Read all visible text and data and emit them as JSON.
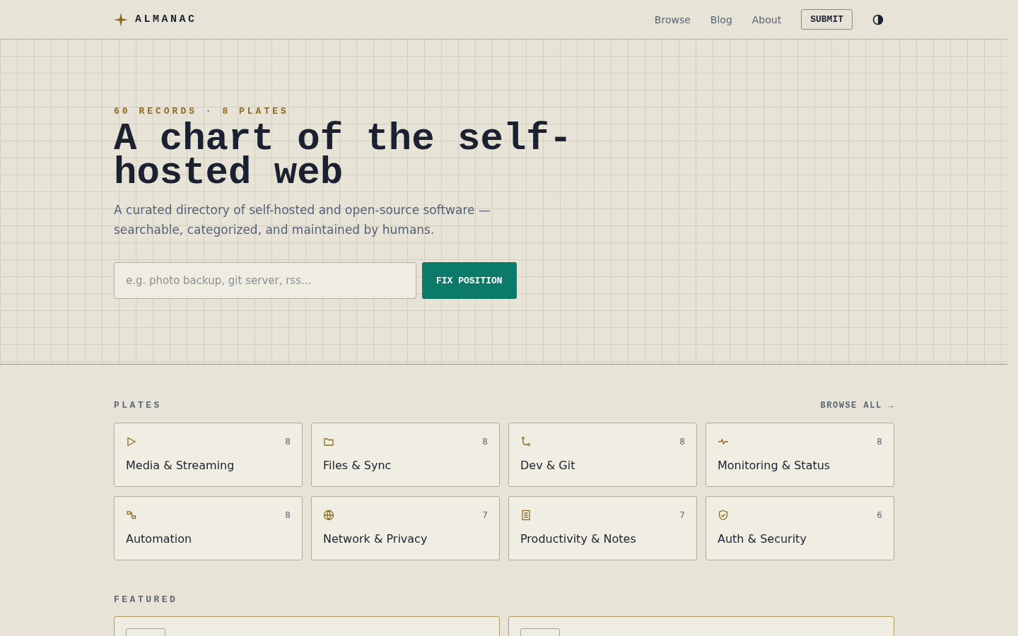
{
  "header": {
    "brand": "ALMANAC",
    "nav": [
      {
        "label": "Browse"
      },
      {
        "label": "Blog"
      },
      {
        "label": "About"
      }
    ],
    "submit": "SUBMIT"
  },
  "hero": {
    "eyebrow": "60 RECORDS · 8 PLATES",
    "title": "A chart of the self-hosted web",
    "lede": "A curated directory of self-hosted and open-source software — searchable, categorized, and maintained by humans.",
    "search": {
      "placeholder": "e.g. photo backup, git server, rss..."
    },
    "button": "FIX POSITION"
  },
  "plates": {
    "heading": "PLATES",
    "browse_all": "BROWSE ALL →",
    "items": [
      {
        "kind": "play",
        "name": "Media & Streaming",
        "count": "8"
      },
      {
        "kind": "folder",
        "name": "Files & Sync",
        "count": "8"
      },
      {
        "kind": "git",
        "name": "Dev & Git",
        "count": "8"
      },
      {
        "kind": "pulse",
        "name": "Monitoring & Status",
        "count": "8"
      },
      {
        "kind": "flow",
        "name": "Automation",
        "count": "8"
      },
      {
        "kind": "globe",
        "name": "Network & Privacy",
        "count": "7"
      },
      {
        "kind": "doc",
        "name": "Productivity & Notes",
        "count": "7"
      },
      {
        "kind": "shield",
        "name": "Auth & Security",
        "count": "6"
      }
    ]
  },
  "featured": {
    "heading": "FEATURED",
    "cards": [
      {
        "kind": "card"
      },
      {
        "kind": "card"
      }
    ]
  }
}
